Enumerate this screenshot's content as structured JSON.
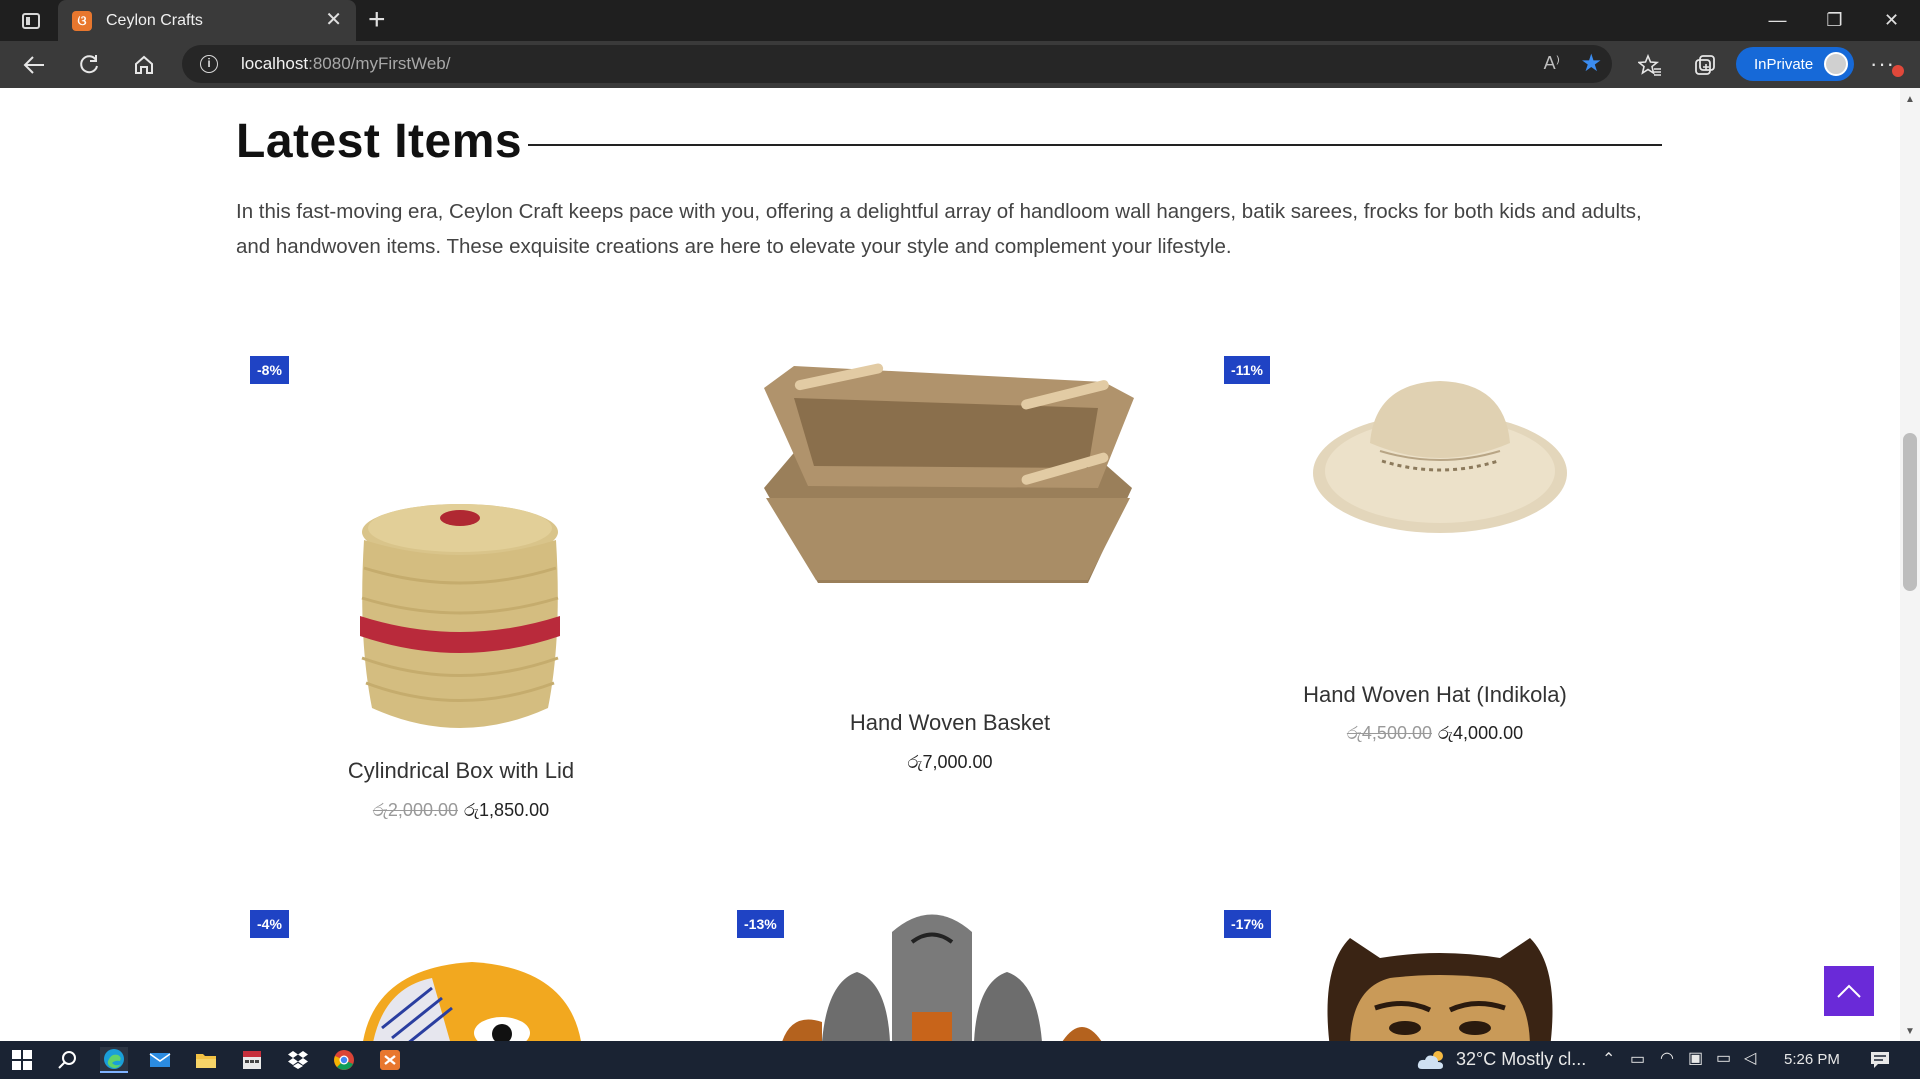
{
  "browser": {
    "tab_title": "Ceylon Crafts",
    "tab_close": "✕",
    "new_tab": "+",
    "url_host": "localhost",
    "url_path": ":8080/myFirstWeb/",
    "inprivate_label": "InPrivate",
    "window_controls": [
      "—",
      "❐",
      "✕"
    ]
  },
  "section": {
    "title": "Latest Items",
    "description": "In this fast-moving era, Ceylon Craft keeps pace with you, offering a delightful array of handloom wall hangers, batik sarees, frocks for both kids and adults, and handwoven items. These exquisite creations are here to elevate your style and complement your lifestyle."
  },
  "products": [
    {
      "name": "Cylindrical Box with Lid",
      "badge": "-8%",
      "old_price": "රු2,000.00",
      "price": "රු1,850.00"
    },
    {
      "name": "Hand Woven Basket",
      "badge": "",
      "old_price": "",
      "price": "රු7,000.00"
    },
    {
      "name": "Hand Woven Hat (Indikola)",
      "badge": "-11%",
      "old_price": "රු4,500.00",
      "price": "රු4,000.00"
    }
  ],
  "row2_badges": [
    "-4%",
    "-13%",
    "-17%"
  ],
  "taskbar": {
    "weather": "32°C  Mostly cl...",
    "time": "5:26 PM"
  },
  "icons": [
    "tab-actions-icon",
    "back-icon",
    "refresh-icon",
    "home-icon",
    "info-icon",
    "read-aloud-icon",
    "favorite-star-icon",
    "favorites-icon",
    "collections-icon",
    "more-icon",
    "scroll-to-top-icon",
    "windows-start-icon",
    "search-icon",
    "edge-icon",
    "mail-icon",
    "file-explorer-icon",
    "calculator-icon",
    "dropbox-icon",
    "chrome-icon",
    "xampp-icon",
    "cloud-icon",
    "notification-icon"
  ]
}
